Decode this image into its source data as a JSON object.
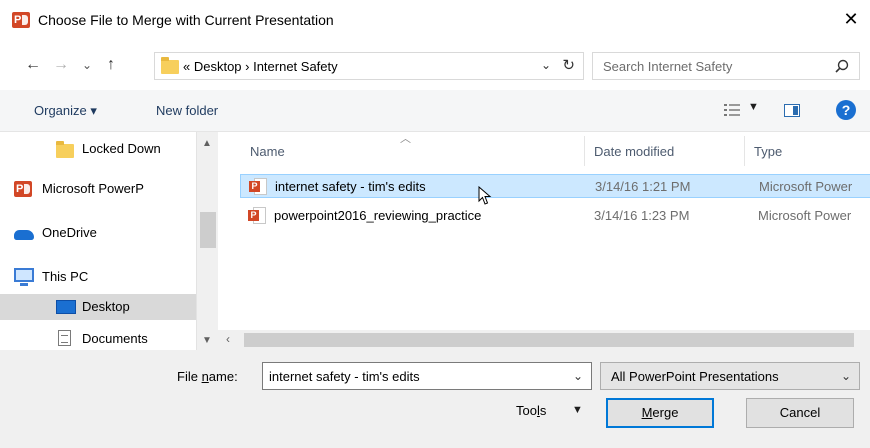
{
  "window": {
    "title": "Choose File to Merge with Current Presentation",
    "close_glyph": "✕"
  },
  "nav": {
    "back": "←",
    "forward": "→",
    "recent": "⌄",
    "up": "↑",
    "address_text": "«  Desktop  ›  Internet Safety",
    "address_drop": "⌄",
    "refresh": "↻",
    "search_placeholder": "Search Internet Safety"
  },
  "toolbar": {
    "organize": "Organize ▾",
    "new_folder": "New folder",
    "view_drop": "▼",
    "help": "?"
  },
  "sidebar": {
    "items": [
      {
        "label": "Locked Down",
        "icon": "folder-icon"
      },
      {
        "label": "Microsoft PowerP",
        "icon": "powerpoint-icon"
      },
      {
        "label": "OneDrive",
        "icon": "onedrive-icon"
      },
      {
        "label": "This PC",
        "icon": "computer-icon"
      },
      {
        "label": "Desktop",
        "icon": "desktop-icon",
        "selected": true
      },
      {
        "label": "Documents",
        "icon": "documents-icon"
      }
    ]
  },
  "columns": {
    "name": "Name",
    "date": "Date modified",
    "type": "Type"
  },
  "files": [
    {
      "name": "internet safety - tim's edits",
      "date": "3/14/16 1:21 PM",
      "type": "Microsoft Power",
      "selected": true
    },
    {
      "name": "powerpoint2016_reviewing_practice",
      "date": "3/14/16 1:23 PM",
      "type": "Microsoft Power",
      "selected": false
    }
  ],
  "footer": {
    "filename_label_pre": "File ",
    "filename_label_u": "n",
    "filename_label_post": "ame:",
    "filename_value": "internet safety - tim's edits",
    "filter_value": "All PowerPoint Presentations",
    "tools_pre": "Too",
    "tools_u": "l",
    "tools_post": "s",
    "merge_u": "M",
    "merge_post": "erge",
    "cancel": "Cancel"
  },
  "colors": {
    "powerpoint": "#d24726",
    "selection": "#cce8ff",
    "accent": "#0078d7"
  }
}
